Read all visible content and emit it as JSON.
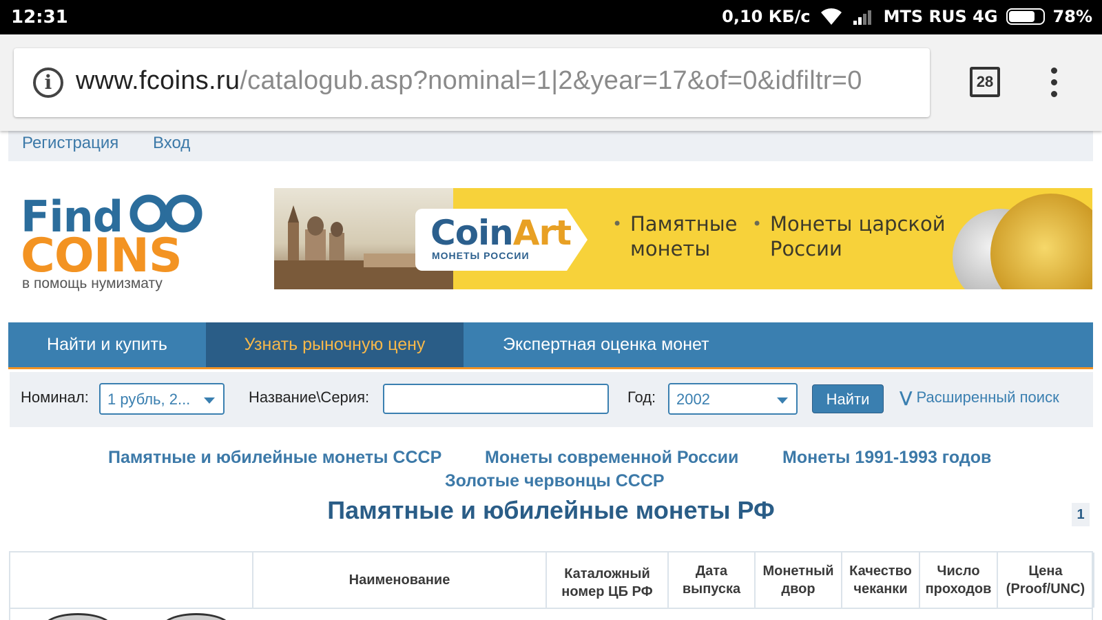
{
  "status_bar": {
    "time": "12:31",
    "speed": "0,10 КБ/с",
    "carrier": "MTS RUS 4G",
    "battery": "78%",
    "battery_level": 0.78
  },
  "browser": {
    "url_host": "www.fcoins.ru",
    "url_path": "/catalogub.asp?nominal=1|2&year=17&of=0&idfiltr=0",
    "tab_count": "28"
  },
  "top_links": [
    "Регистрация",
    "Вход"
  ],
  "logo": {
    "find": "Find",
    "coins": "COINS",
    "tagline": "в помощь нумизмату"
  },
  "banner": {
    "brand_coin": "Coin",
    "brand_art": "Art",
    "brand_sub": "МОНЕТЫ РОССИИ",
    "bullet1_line1": "Памятные",
    "bullet1_line2": "монеты",
    "bullet2_line1": "Монеты царской",
    "bullet2_line2": "России"
  },
  "nav": {
    "items": [
      "Найти и купить",
      "Узнать рыночную цену",
      "Экспертная оценка монет"
    ],
    "active_index": 1
  },
  "search": {
    "nominal_label": "Номинал:",
    "nominal_value": "1 рубль, 2...",
    "name_label": "Название\\Серия:",
    "name_value": "",
    "year_label": "Год:",
    "year_value": "2002",
    "find_button": "Найти",
    "advanced": "Расширенный поиск"
  },
  "categories": [
    "Памятные и юбилейные монеты СССР",
    "Монеты современной России",
    "Монеты 1991-1993 годов",
    "Золотые червонцы СССР"
  ],
  "page_title": "Памятные и юбилейные монеты РФ",
  "page_number": "1",
  "table": {
    "headers": [
      "",
      "Наименование",
      "Каталожный номер ЦБ РФ",
      "Дата выпуска",
      "Монетный двор",
      "Качество чеканки",
      "Число проходов",
      "Цена (Proof/UNC)"
    ]
  },
  "colors": {
    "brand_blue": "#3a7fb0",
    "brand_orange": "#f39322",
    "nav_active": "#2a5d87"
  }
}
